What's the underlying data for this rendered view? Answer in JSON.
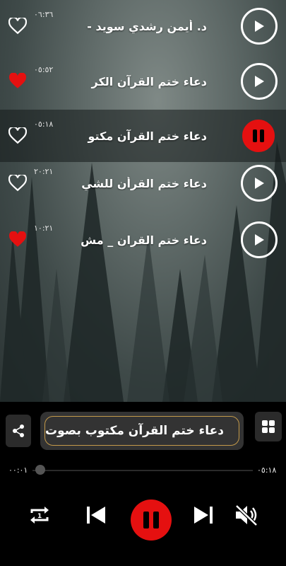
{
  "playlist": [
    {
      "title": "د. أيمن رشدي سويد -",
      "duration": "٠٦:٣٦",
      "favorite": false,
      "state": "idle"
    },
    {
      "title": "دعاء ختم القرآن الكر",
      "duration": "٠٥:٥٢",
      "favorite": true,
      "state": "idle"
    },
    {
      "title": "دعاء ختم القرآن مكتو",
      "duration": "٠٥:١٨",
      "favorite": false,
      "state": "playing"
    },
    {
      "title": "دعاء ختم القرأن للشي",
      "duration": "٢٠:٢١",
      "favorite": false,
      "state": "idle"
    },
    {
      "title": "دعاء ختم القران _ مش",
      "duration": "١٠:٢١",
      "favorite": true,
      "state": "idle"
    }
  ],
  "player": {
    "now_playing": "دعاء ختم القرآن مكتوب بصوت",
    "elapsed": "٠٠:٠١",
    "total": "٠٥:١٨",
    "progress": 0.01
  },
  "icons": {
    "share": "share-icon",
    "grid": "grid-icon",
    "repeat": "repeat-one-icon",
    "prev": "skip-previous-icon",
    "pause": "pause-icon",
    "next": "skip-next-icon",
    "mute": "volume-off-icon"
  },
  "colors": {
    "accent": "#e51010",
    "frame": "#c49a4a"
  }
}
